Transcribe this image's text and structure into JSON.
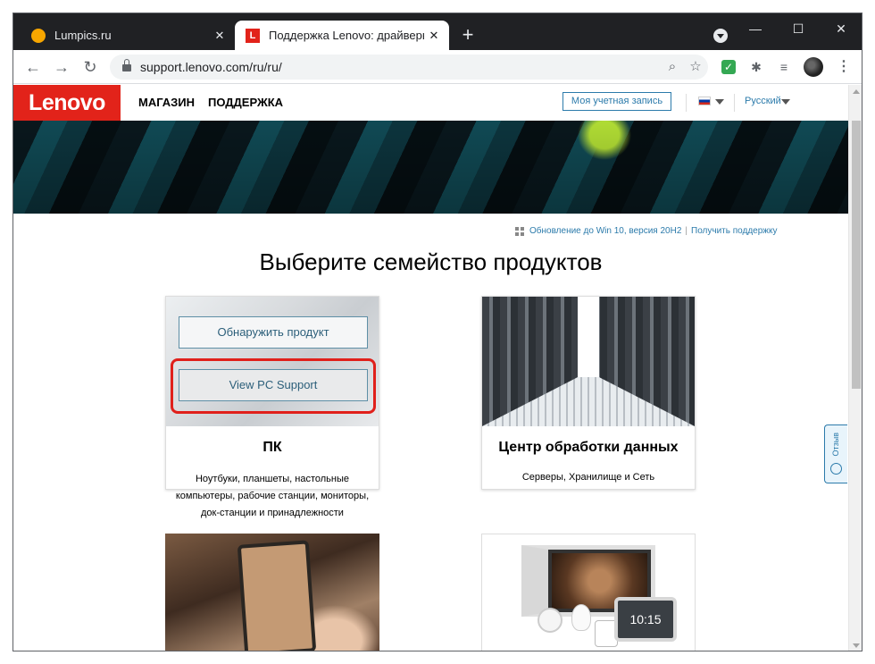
{
  "browser": {
    "tabs": [
      {
        "title": "Lumpics.ru",
        "active": false
      },
      {
        "title": "Поддержка Lenovo: драйверы, с",
        "active": true
      }
    ],
    "url": "support.lenovo.com/ru/ru/",
    "new_tab_label": "+",
    "window_controls": {
      "minimize": "—",
      "maximize": "☐",
      "close": "✕"
    }
  },
  "site": {
    "logo_text": "Lenovo",
    "nav": [
      "МАГАЗИН",
      "ПОДДЕРЖКА"
    ],
    "account_button": "Моя учетная запись",
    "language": "Русский",
    "top_links": [
      "Обновление до Win 10, версия 20H2",
      "Получить поддержку"
    ],
    "link_separator": "|",
    "page_title": "Выберите семейство продуктов",
    "cards": {
      "pc": {
        "detect_button": "Обнаружить продукт",
        "view_button": "View PC Support",
        "title": "ПК",
        "description_lines": [
          "Ноутбуки, планшеты, настольные",
          "компьютеры, рабочие станции, мониторы,",
          "док-станции и принадлежности"
        ]
      },
      "datacenter": {
        "title": "Центр обработки данных",
        "subtitle": "Серверы, Хранилище и Сеть"
      },
      "smart_clock_time": "10:15"
    },
    "feedback_label": "Отзыв"
  },
  "colors": {
    "brand_red": "#e2231a",
    "link_blue": "#2c7bab",
    "highlight_red": "#e0201b"
  }
}
